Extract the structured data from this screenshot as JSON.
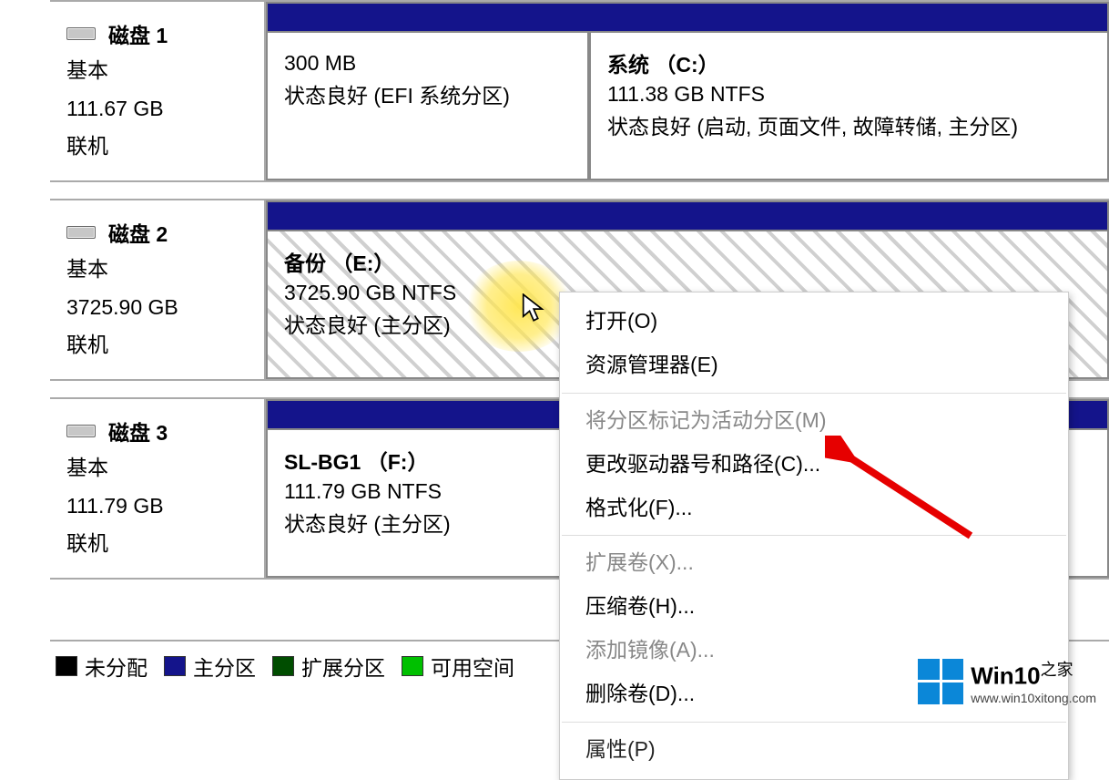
{
  "disks": [
    {
      "name": "磁盘 1",
      "type": "基本",
      "size": "111.67 GB",
      "status": "联机",
      "partitions": [
        {
          "name": "",
          "size": "300 MB",
          "status": "状态良好 (EFI 系统分区)"
        },
        {
          "name": "系统 （C:）",
          "size": "111.38 GB NTFS",
          "status": "状态良好 (启动, 页面文件, 故障转储, 主分区)"
        }
      ]
    },
    {
      "name": "磁盘 2",
      "type": "基本",
      "size": "3725.90 GB",
      "status": "联机",
      "partitions": [
        {
          "name": "备份 （E:）",
          "size": "3725.90 GB NTFS",
          "status": "状态良好 (主分区)"
        }
      ]
    },
    {
      "name": "磁盘 3",
      "type": "基本",
      "size": "111.79 GB",
      "status": "联机",
      "partitions": [
        {
          "name": "SL-BG1 （F:）",
          "size": "111.79 GB NTFS",
          "status": "状态良好 (主分区)"
        }
      ]
    }
  ],
  "legend": {
    "unallocated": "未分配",
    "primary": "主分区",
    "extended": "扩展分区",
    "free": "可用空间"
  },
  "context_menu": {
    "open": "打开(O)",
    "explorer": "资源管理器(E)",
    "mark_active": "将分区标记为活动分区(M)",
    "change_letter": "更改驱动器号和路径(C)...",
    "format": "格式化(F)...",
    "extend": "扩展卷(X)...",
    "shrink": "压缩卷(H)...",
    "add_mirror": "添加镜像(A)...",
    "delete": "删除卷(D)...",
    "properties": "属性(P)"
  },
  "watermark": {
    "title_main": "Win10",
    "title_suffix": "之家",
    "url": "www.win10xitong.com"
  }
}
